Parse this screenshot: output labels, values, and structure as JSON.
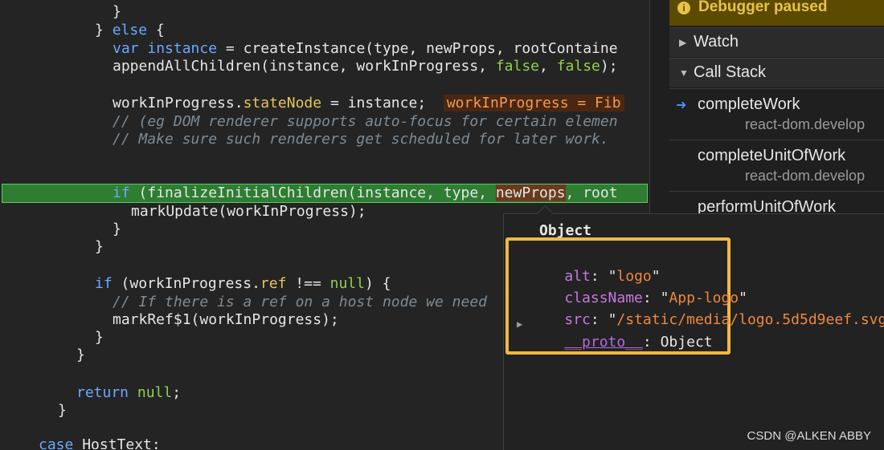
{
  "editor": {
    "lines": {
      "l0": "}",
      "l1a": "} ",
      "l1b": "else",
      "l1c": " {",
      "l2a": "var",
      "l2b": " ",
      "l2c": "instance",
      "l2d": " = createInstance(type, newProps, rootContaine",
      "l3a": "appendAllChildren(instance, workInProgress, ",
      "l3b": "false",
      "l3c": ", ",
      "l3d": "false",
      "l3e": ");",
      "l5a": "workInProgress.",
      "l5b": "stateNode",
      "l5c": " = instance;  ",
      "l5inline": "workInProgress = Fib",
      "l6": "// (eg DOM renderer supports auto-focus for certain elemen",
      "l7": "// Make sure such renderers get scheduled for later work.",
      "l9a": "if",
      "l9b": " (finalizeInitialChildren(instance, type, ",
      "l9c": "newProps",
      "l9d": ", root",
      "l10": "markUpdate(workInProgress);",
      "l11": "}",
      "l12": "}",
      "l14a": "if",
      "l14b": " (workInProgress.",
      "l14c": "ref",
      "l14d": " !== ",
      "l14e": "null",
      "l14f": ") {",
      "l15": "// If there is a ref on a host node we need",
      "l16": "markRef$1(workInProgress);",
      "l17": "}",
      "l18": "}",
      "l20a": "return",
      "l20b": " ",
      "l20c": "null",
      "l20d": ";",
      "l21": "}",
      "l23a": "case",
      "l23b": " HostText:"
    }
  },
  "debugger": {
    "banner": "Debugger paused",
    "info_icon": "i",
    "watch_label": "Watch",
    "callstack_label": "Call Stack",
    "frames": [
      {
        "fn": "completeWork",
        "src": "react-dom.develop"
      },
      {
        "fn": "completeUnitOfWork",
        "src": "react-dom.develop"
      },
      {
        "fn": "performUnitOfWork",
        "src": ""
      }
    ]
  },
  "popup": {
    "title": "Object",
    "props": [
      {
        "key": "alt",
        "value": "logo"
      },
      {
        "key": "className",
        "value": "App-logo"
      },
      {
        "key": "src",
        "value": "/static/media/logo.5d5d9eef.svg"
      }
    ],
    "proto_key": "__proto__",
    "proto_value": "Object"
  },
  "watermark": "CSDN @ALKEN  ABBY",
  "colors": {
    "exec_line": "#2e7d32",
    "highlight_border": "#f2b83f",
    "paused_banner": "#5c4a00"
  }
}
